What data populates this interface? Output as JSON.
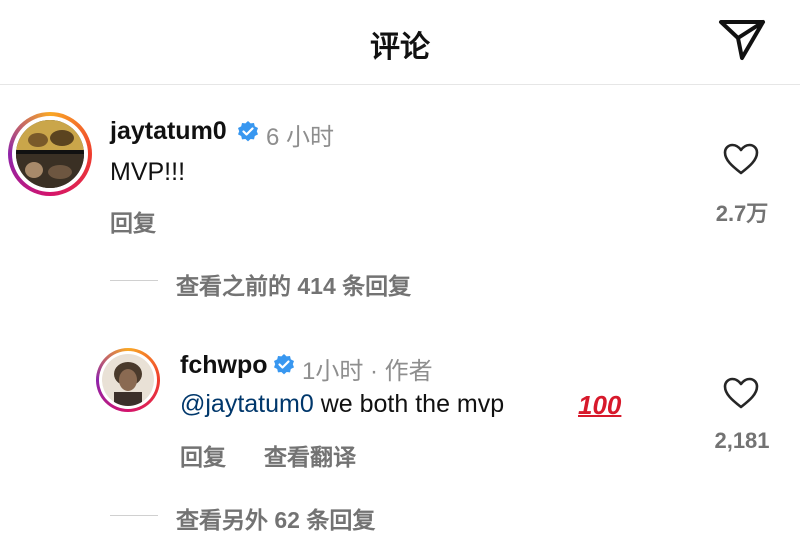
{
  "header": {
    "title": "评论",
    "send_icon": "send-icon"
  },
  "comments": [
    {
      "username": "jaytatum0",
      "time": "6 小时",
      "text": "MVP!!!",
      "reply_label": "回复",
      "likes": "2.7万"
    }
  ],
  "replies_toggle_1": "查看之前的 414 条回复",
  "reply": {
    "username": "fchwpo",
    "time": "1小时 · 作者",
    "mention": "@jaytatum0",
    "text": " we both the mvp",
    "emoji": "100",
    "reply_label": "回复",
    "translate_label": "查看翻译",
    "likes": "2,181"
  },
  "replies_toggle_2": "查看另外 62 条回复",
  "colors": {
    "accent_verified": "#3897f0",
    "mention": "#00376b",
    "muted": "#737373"
  }
}
